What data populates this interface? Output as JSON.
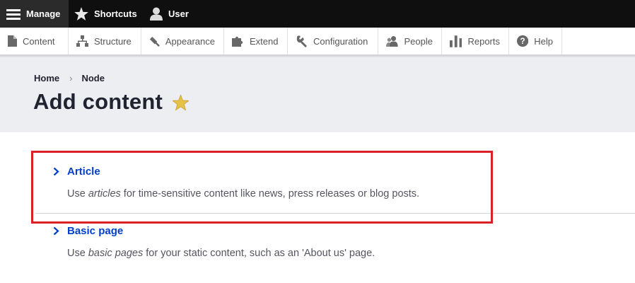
{
  "toolbar": {
    "manage_label": "Manage",
    "shortcuts_label": "Shortcuts",
    "user_label": "User"
  },
  "tray": {
    "items": [
      {
        "label": "Content",
        "icon": "file-icon"
      },
      {
        "label": "Structure",
        "icon": "structure-icon"
      },
      {
        "label": "Appearance",
        "icon": "paintbrush-icon"
      },
      {
        "label": "Extend",
        "icon": "puzzle-icon"
      },
      {
        "label": "Configuration",
        "icon": "wrench-icon"
      },
      {
        "label": "People",
        "icon": "people-icon"
      },
      {
        "label": "Reports",
        "icon": "bar-chart-icon"
      },
      {
        "label": "Help",
        "icon": "help-icon"
      }
    ]
  },
  "breadcrumb": {
    "home": "Home",
    "separator": "›",
    "node": "Node"
  },
  "page_title": "Add content",
  "content_types": [
    {
      "label": "Article",
      "desc_pre": "Use ",
      "desc_em": "articles",
      "desc_post": " for time-sensitive content like news, press releases or blog posts."
    },
    {
      "label": "Basic page",
      "desc_pre": "Use ",
      "desc_em": "basic pages",
      "desc_post": " for your static content, such as an 'About us' page."
    }
  ],
  "colors": {
    "toolbar_bg": "#0f0f0f",
    "link": "#003ecc",
    "highlight": "#dc2027",
    "star": "#e6c14a"
  }
}
